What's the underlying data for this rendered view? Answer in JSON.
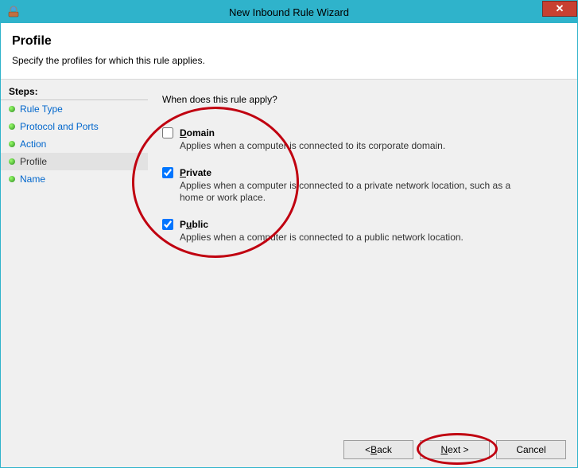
{
  "window": {
    "title": "New Inbound Rule Wizard",
    "close_symbol": "✕"
  },
  "header": {
    "title": "Profile",
    "subtitle": "Specify the profiles for which this rule applies."
  },
  "steps": {
    "label": "Steps:",
    "items": [
      {
        "label": "Rule Type"
      },
      {
        "label": "Protocol and Ports"
      },
      {
        "label": "Action"
      },
      {
        "label": "Profile"
      },
      {
        "label": "Name"
      }
    ]
  },
  "content": {
    "question": "When does this rule apply?",
    "options": {
      "domain": {
        "accel": "D",
        "rest": "omain",
        "desc": "Applies when a computer is connected to its corporate domain.",
        "checked": false
      },
      "private": {
        "accel": "P",
        "rest": "rivate",
        "desc": "Applies when a computer is connected to a private network location, such as a home or work place.",
        "checked": true
      },
      "public": {
        "pre": "P",
        "accel": "u",
        "rest": "blic",
        "desc": "Applies when a computer is connected to a public network location.",
        "checked": true
      }
    }
  },
  "buttons": {
    "back_pre": "< ",
    "back_accel": "B",
    "back_rest": "ack",
    "next_accel": "N",
    "next_rest": "ext >",
    "cancel": "Cancel"
  }
}
